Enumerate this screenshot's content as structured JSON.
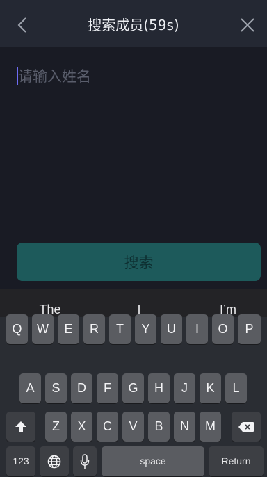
{
  "header": {
    "title": "搜索成员(59s)",
    "back_icon": "chevron-left-icon",
    "close_icon": "close-icon"
  },
  "form": {
    "name_placeholder": "请输入姓名",
    "name_value": "",
    "search_label": "搜索"
  },
  "keyboard": {
    "suggestions": [
      "The",
      "I",
      "I’m"
    ],
    "row1": [
      "Q",
      "W",
      "E",
      "R",
      "T",
      "Y",
      "U",
      "I",
      "O",
      "P"
    ],
    "row2": [
      "A",
      "S",
      "D",
      "F",
      "G",
      "H",
      "J",
      "K",
      "L"
    ],
    "row3": [
      "Z",
      "X",
      "C",
      "V",
      "B",
      "N",
      "M"
    ],
    "numbers_label": "123",
    "space_label": "space",
    "return_label": "Return",
    "shift_icon": "shift-icon",
    "delete_icon": "backspace-icon",
    "globe_icon": "globe-icon",
    "mic_icon": "microphone-icon"
  },
  "colors": {
    "background": "#191b24",
    "header": "#242833",
    "button": "#1d5a5b",
    "caret": "#6e6cf2"
  }
}
